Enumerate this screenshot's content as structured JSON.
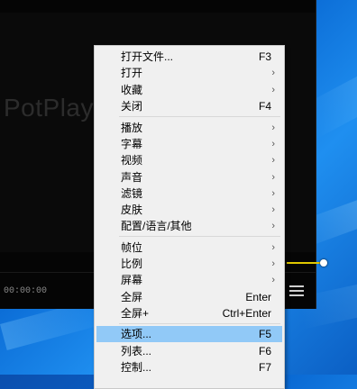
{
  "player": {
    "logo_text": "PotPlay",
    "time": "00:00:00"
  },
  "menu": {
    "items": [
      {
        "label": "打开文件...",
        "shortcut": "F3",
        "submenu": false
      },
      {
        "label": "打开",
        "shortcut": "",
        "submenu": true
      },
      {
        "label": "收藏",
        "shortcut": "",
        "submenu": true
      },
      {
        "label": "关闭",
        "shortcut": "F4",
        "submenu": false
      },
      {
        "label": "播放",
        "shortcut": "",
        "submenu": true
      },
      {
        "label": "字幕",
        "shortcut": "",
        "submenu": true
      },
      {
        "label": "视频",
        "shortcut": "",
        "submenu": true
      },
      {
        "label": "声音",
        "shortcut": "",
        "submenu": true
      },
      {
        "label": "滤镜",
        "shortcut": "",
        "submenu": true
      },
      {
        "label": "皮肤",
        "shortcut": "",
        "submenu": true
      },
      {
        "label": "配置/语言/其他",
        "shortcut": "",
        "submenu": true
      },
      {
        "label": "帧位",
        "shortcut": "",
        "submenu": true
      },
      {
        "label": "比例",
        "shortcut": "",
        "submenu": true
      },
      {
        "label": "屏幕",
        "shortcut": "",
        "submenu": true
      },
      {
        "label": "全屏",
        "shortcut": "Enter",
        "submenu": false
      },
      {
        "label": "全屏+",
        "shortcut": "Ctrl+Enter",
        "submenu": false
      },
      {
        "label": "选项...",
        "shortcut": "F5",
        "submenu": false,
        "highlighted": true
      },
      {
        "label": "列表...",
        "shortcut": "F6",
        "submenu": false
      },
      {
        "label": "控制...",
        "shortcut": "F7",
        "submenu": false
      }
    ],
    "arrow_glyph": "›"
  },
  "colors": {
    "highlight": "#91c9f7",
    "menu_bg": "#f0f0f0",
    "seek_accent": "#e0c800"
  }
}
